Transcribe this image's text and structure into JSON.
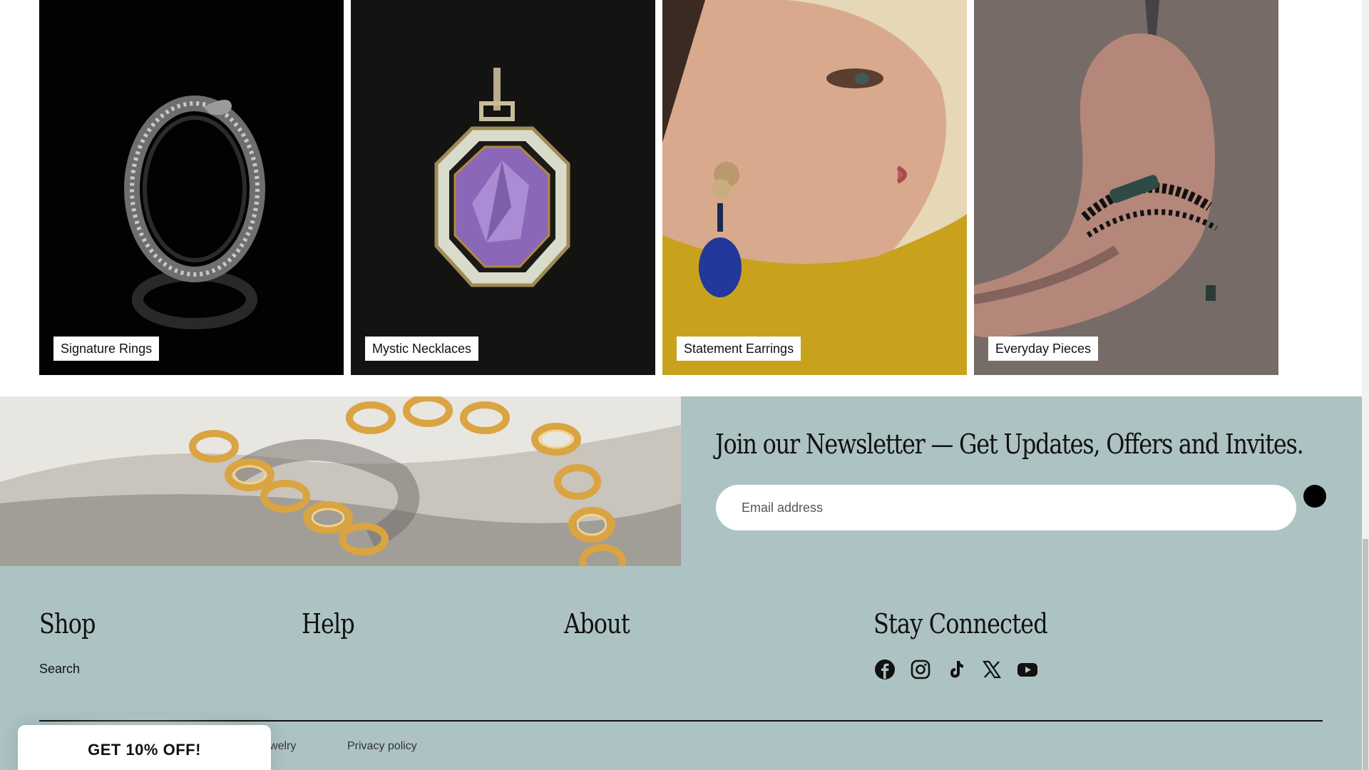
{
  "collections": [
    {
      "label": "Signature Rings"
    },
    {
      "label": "Mystic Necklaces"
    },
    {
      "label": "Statement Earrings"
    },
    {
      "label": "Everyday Pieces"
    }
  ],
  "newsletter": {
    "title": "Join our Newsletter — Get Updates, Offers and Invites.",
    "email_placeholder": "Email address"
  },
  "footer": {
    "shop_title": "Shop",
    "help_title": "Help",
    "about_title": "About",
    "connect_title": "Stay Connected",
    "shop_links": [
      "Search"
    ],
    "social": [
      "facebook-icon",
      "instagram-icon",
      "tiktok-icon",
      "x-icon",
      "youtube-icon"
    ],
    "copyright": "one Jewelry",
    "privacy_label": "Privacy policy"
  },
  "promo": {
    "label": "GET 10% OFF!"
  },
  "colors": {
    "footer_bg": "#adc3c3",
    "accent": "#000000"
  }
}
